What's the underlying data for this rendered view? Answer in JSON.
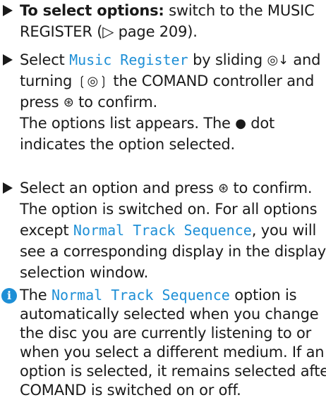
{
  "colors": {
    "accent": "#1e8fd6",
    "text": "#1a1a1a"
  },
  "steps": [
    {
      "label": "To select options:",
      "text1": " switch to the MUSIC",
      "text2": "REGISTER (▷ page 209)."
    },
    {
      "a": "Select ",
      "mono": "Music Register",
      "b": " by sliding ",
      "g1": "◎↓",
      "c": " and",
      "d": "turning ",
      "g2": "❲◎❳",
      "e": " the COMAND controller and",
      "f": "press ",
      "g3": "⊛",
      "g": " to confirm.",
      "h": "The options list appears. The ",
      "g4": "●",
      "i": " dot",
      "j": "indicates the option selected."
    },
    {
      "a": "Select an option and press ",
      "g1": "⊛",
      "b": " to confirm.",
      "c": "The option is switched on. For all options",
      "d": "except ",
      "mono": "Normal Track Sequence",
      "e": ", you will",
      "f": "see a corresponding display in the display/",
      "g": "selection window."
    }
  ],
  "info": {
    "icon": "i",
    "a": "The ",
    "mono": "Normal Track Sequence",
    "b": " option is",
    "c": "automatically selected when you change",
    "d": "the disc you are currently listening to or",
    "e": "when you select a different medium. If an",
    "f": "option is selected, it remains selected after",
    "g": "COMAND is switched on or off."
  }
}
